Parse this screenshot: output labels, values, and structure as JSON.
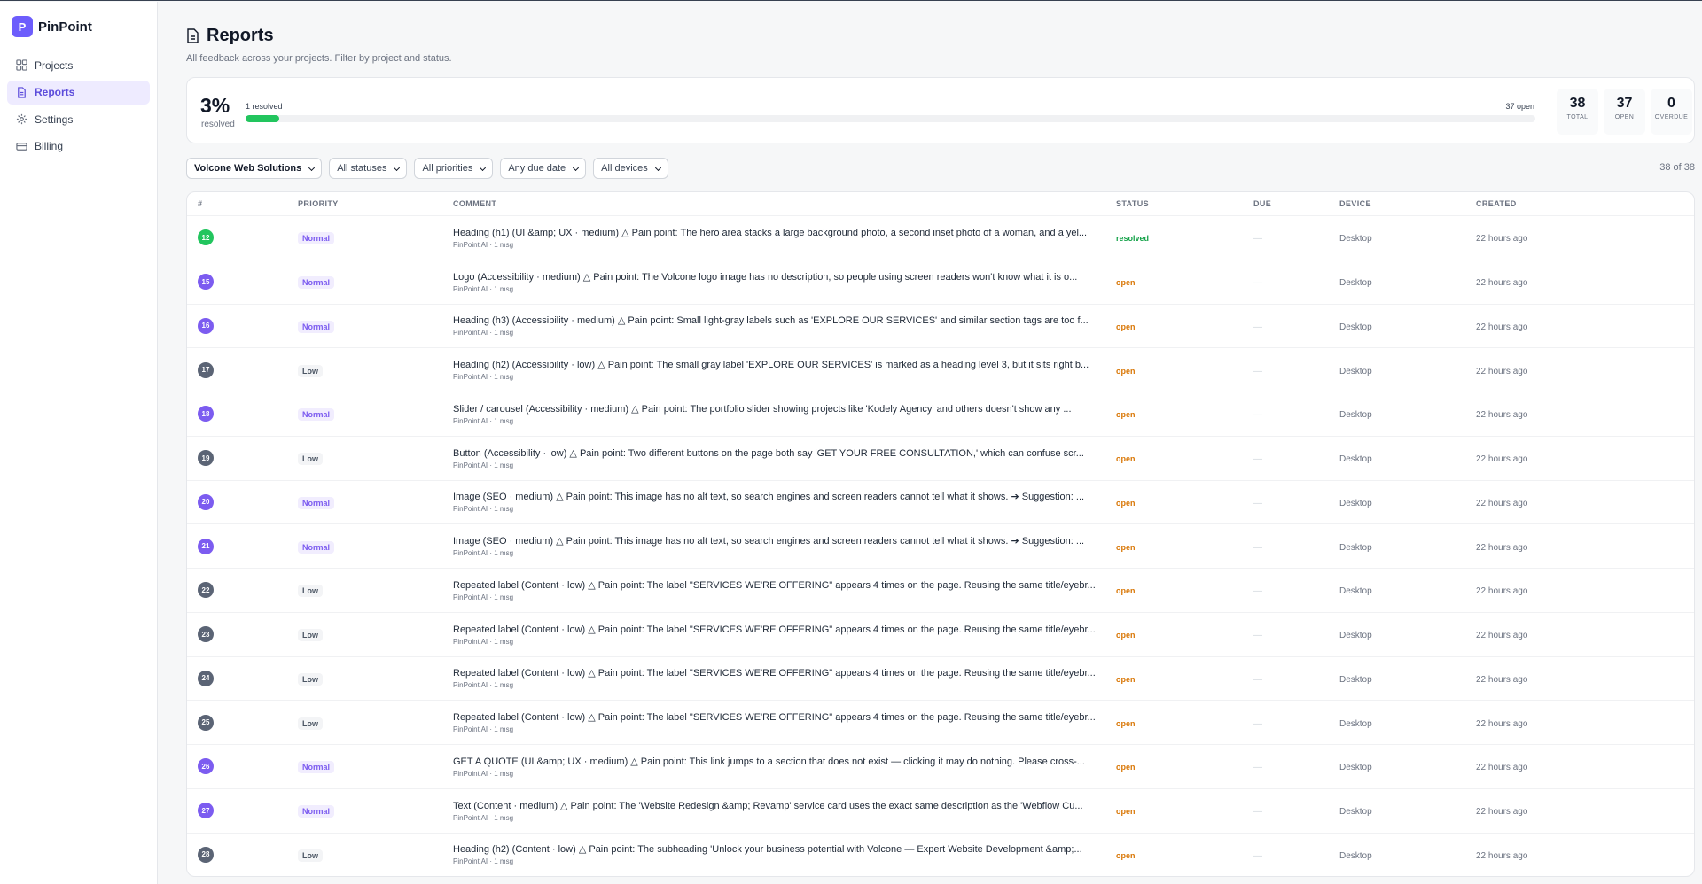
{
  "brand": {
    "logo_letter": "P",
    "name": "PinPoint",
    "accent": "#6d5dfc"
  },
  "sidebar": {
    "items": [
      {
        "label": "Projects",
        "icon": "grid-icon"
      },
      {
        "label": "Reports",
        "icon": "document-icon",
        "active": true
      },
      {
        "label": "Settings",
        "icon": "gear-icon"
      },
      {
        "label": "Billing",
        "icon": "card-icon"
      }
    ]
  },
  "header": {
    "title": "Reports",
    "subtitle": "All feedback across your projects. Filter by project and status."
  },
  "summary": {
    "percent": "3%",
    "percent_label": "resolved",
    "resolved_text": "1 resolved",
    "open_text": "37 open",
    "progress_fraction": 0.026,
    "stats": [
      {
        "value": "38",
        "label": "TOTAL"
      },
      {
        "value": "37",
        "label": "OPEN"
      },
      {
        "value": "0",
        "label": "OVERDUE"
      }
    ]
  },
  "filters": {
    "project": "Volcone Web Solutions",
    "status": "All statuses",
    "priority": "All priorities",
    "due": "Any due date",
    "device": "All devices",
    "count": "38 of 38"
  },
  "table": {
    "headers": [
      "#",
      "PRIORITY",
      "COMMENT",
      "STATUS",
      "DUE",
      "DEVICE",
      "CREATED"
    ],
    "rows": [
      {
        "num": "12",
        "priority": "Normal",
        "comment": "Heading (h1) (UI &amp; UX · medium) △ Pain point: The hero area stacks a large background photo, a second inset photo of a woman, and a yel...",
        "sub": "PinPoint AI · 1 msg",
        "status": "resolved",
        "due": "—",
        "device": "Desktop",
        "created": "22 hours ago"
      },
      {
        "num": "15",
        "priority": "Normal",
        "comment": "Logo (Accessibility · medium) △ Pain point: The Volcone logo image has no description, so people using screen readers won't know what it is o...",
        "sub": "PinPoint AI · 1 msg",
        "status": "open",
        "due": "—",
        "device": "Desktop",
        "created": "22 hours ago"
      },
      {
        "num": "16",
        "priority": "Normal",
        "comment": "Heading (h3) (Accessibility · medium) △ Pain point: Small light-gray labels such as 'EXPLORE OUR SERVICES' and similar section tags are too f...",
        "sub": "PinPoint AI · 1 msg",
        "status": "open",
        "due": "—",
        "device": "Desktop",
        "created": "22 hours ago"
      },
      {
        "num": "17",
        "priority": "Low",
        "comment": "Heading (h2) (Accessibility · low) △ Pain point: The small gray label 'EXPLORE OUR SERVICES' is marked as a heading level 3, but it sits right b...",
        "sub": "PinPoint AI · 1 msg",
        "status": "open",
        "due": "—",
        "device": "Desktop",
        "created": "22 hours ago"
      },
      {
        "num": "18",
        "priority": "Normal",
        "comment": "Slider / carousel (Accessibility · medium) △ Pain point: The portfolio slider showing projects like 'Kodely Agency' and others doesn't show any ...",
        "sub": "PinPoint AI · 1 msg",
        "status": "open",
        "due": "—",
        "device": "Desktop",
        "created": "22 hours ago"
      },
      {
        "num": "19",
        "priority": "Low",
        "comment": "Button (Accessibility · low) △ Pain point: Two different buttons on the page both say 'GET YOUR FREE CONSULTATION,' which can confuse scr...",
        "sub": "PinPoint AI · 1 msg",
        "status": "open",
        "due": "—",
        "device": "Desktop",
        "created": "22 hours ago"
      },
      {
        "num": "20",
        "priority": "Normal",
        "comment": "Image (SEO · medium) △ Pain point: This image has no alt text, so search engines and screen readers cannot tell what it shows. ➔ Suggestion: ...",
        "sub": "PinPoint AI · 1 msg",
        "status": "open",
        "due": "—",
        "device": "Desktop",
        "created": "22 hours ago"
      },
      {
        "num": "21",
        "priority": "Normal",
        "comment": "Image (SEO · medium) △ Pain point: This image has no alt text, so search engines and screen readers cannot tell what it shows. ➔ Suggestion: ...",
        "sub": "PinPoint AI · 1 msg",
        "status": "open",
        "due": "—",
        "device": "Desktop",
        "created": "22 hours ago"
      },
      {
        "num": "22",
        "priority": "Low",
        "comment": "Repeated label (Content · low) △ Pain point: The label \"SERVICES WE'RE OFFERING\" appears 4 times on the page. Reusing the same title/eyebr...",
        "sub": "PinPoint AI · 1 msg",
        "status": "open",
        "due": "—",
        "device": "Desktop",
        "created": "22 hours ago"
      },
      {
        "num": "23",
        "priority": "Low",
        "comment": "Repeated label (Content · low) △ Pain point: The label \"SERVICES WE'RE OFFERING\" appears 4 times on the page. Reusing the same title/eyebr...",
        "sub": "PinPoint AI · 1 msg",
        "status": "open",
        "due": "—",
        "device": "Desktop",
        "created": "22 hours ago"
      },
      {
        "num": "24",
        "priority": "Low",
        "comment": "Repeated label (Content · low) △ Pain point: The label \"SERVICES WE'RE OFFERING\" appears 4 times on the page. Reusing the same title/eyebr...",
        "sub": "PinPoint AI · 1 msg",
        "status": "open",
        "due": "—",
        "device": "Desktop",
        "created": "22 hours ago"
      },
      {
        "num": "25",
        "priority": "Low",
        "comment": "Repeated label (Content · low) △ Pain point: The label \"SERVICES WE'RE OFFERING\" appears 4 times on the page. Reusing the same title/eyebr...",
        "sub": "PinPoint AI · 1 msg",
        "status": "open",
        "due": "—",
        "device": "Desktop",
        "created": "22 hours ago"
      },
      {
        "num": "26",
        "priority": "Normal",
        "comment": "GET A QUOTE (UI &amp; UX · medium) △ Pain point: This link jumps to a section that does not exist — clicking it may do nothing. Please cross-...",
        "sub": "PinPoint AI · 1 msg",
        "status": "open",
        "due": "—",
        "device": "Desktop",
        "created": "22 hours ago"
      },
      {
        "num": "27",
        "priority": "Normal",
        "comment": "Text (Content · medium) △ Pain point: The 'Website Redesign &amp; Revamp' service card uses the exact same description as the 'Webflow Cu...",
        "sub": "PinPoint AI · 1 msg",
        "status": "open",
        "due": "—",
        "device": "Desktop",
        "created": "22 hours ago"
      },
      {
        "num": "28",
        "priority": "Low",
        "comment": "Heading (h2) (Content · low) △ Pain point: The subheading 'Unlock your business potential with Volcone — Expert Website Development &amp;...",
        "sub": "PinPoint AI · 1 msg",
        "status": "open",
        "due": "—",
        "device": "Desktop",
        "created": "22 hours ago"
      }
    ]
  },
  "colors": {
    "accent": "#6d5dfc",
    "resolved": "#22c55e",
    "open": "#d97706",
    "normal_badge": "#7c5cf0",
    "low_badge": "#5b6475"
  }
}
